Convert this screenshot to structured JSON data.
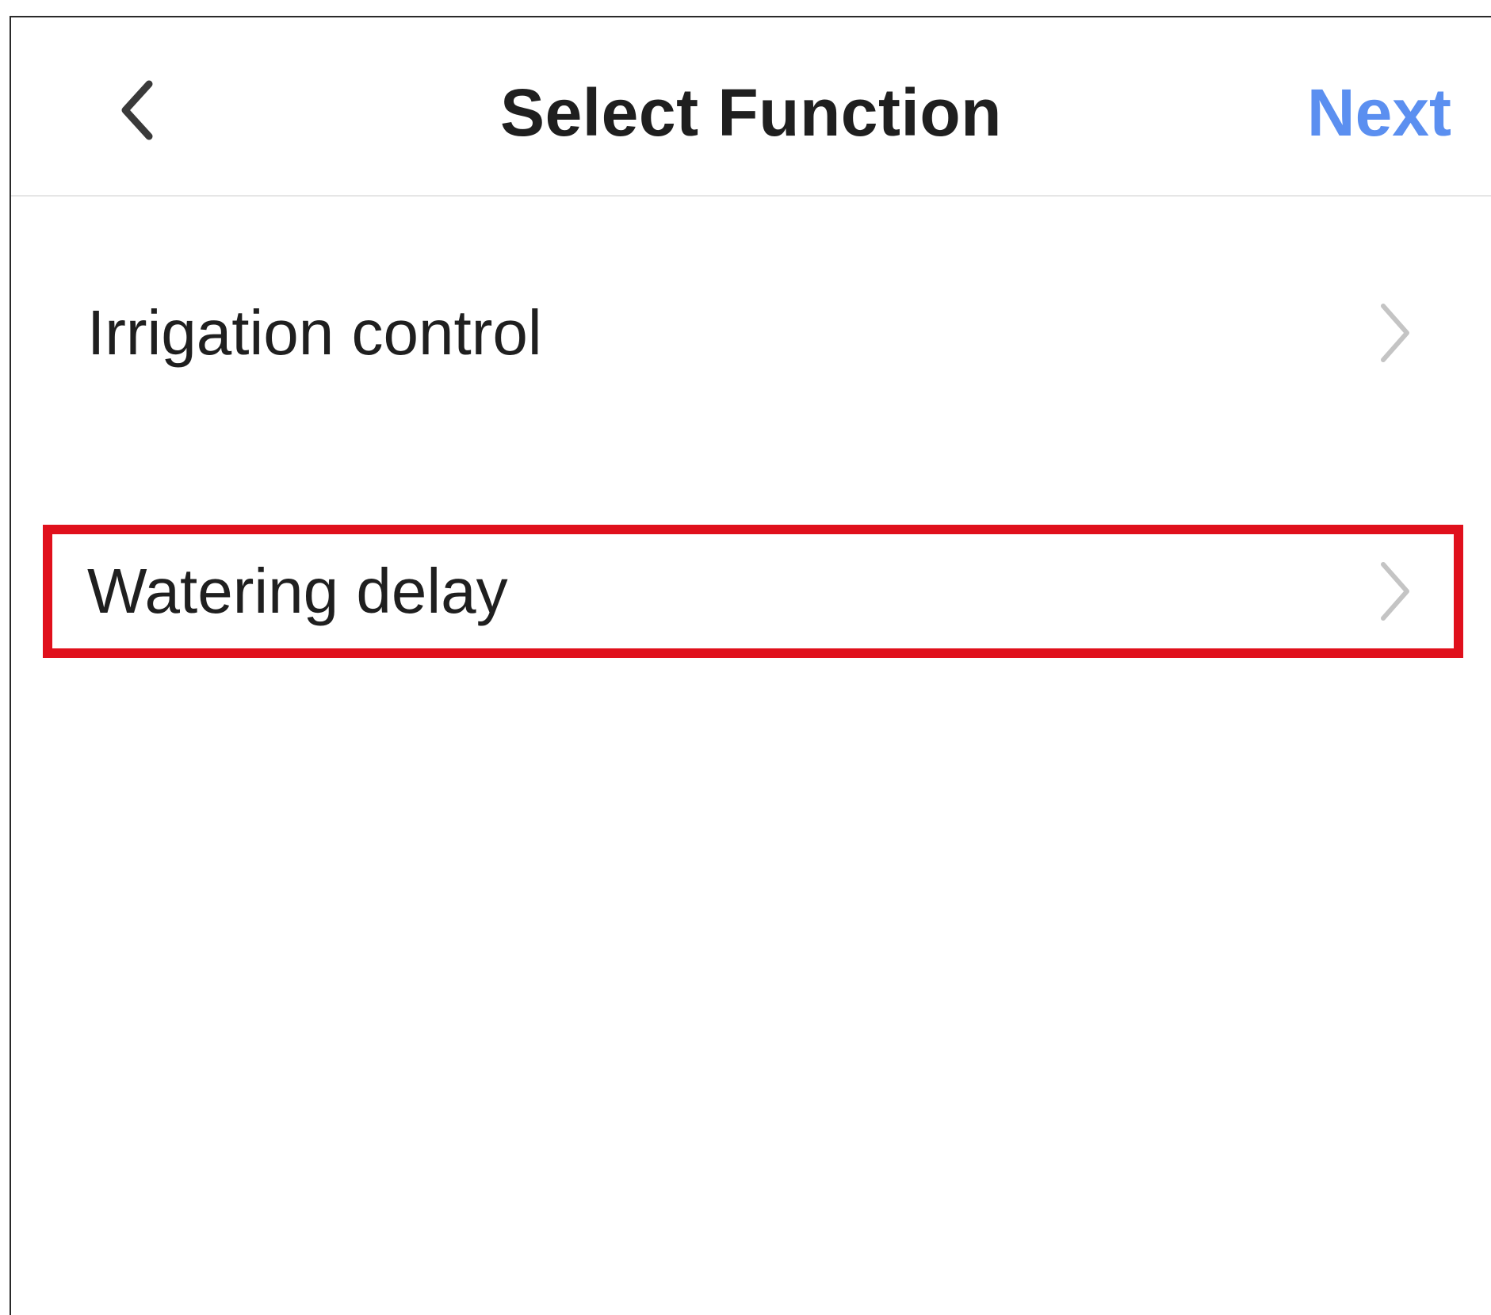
{
  "header": {
    "title": "Select Function",
    "next_label": "Next",
    "back_icon": "chevron-left-icon"
  },
  "functions": {
    "items": [
      {
        "label": "Irrigation control",
        "icon": "chevron-right-icon",
        "highlighted": false
      },
      {
        "label": "Watering delay",
        "icon": "chevron-right-icon",
        "highlighted": true
      }
    ]
  },
  "colors": {
    "accent": "#5b8ff0",
    "highlight": "#e0101c",
    "text": "#1f1f1f",
    "chevron": "#c4c4c4"
  }
}
